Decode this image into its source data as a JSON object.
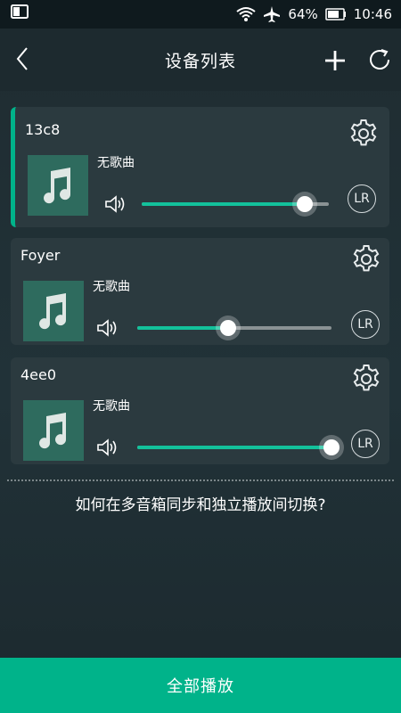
{
  "status_bar": {
    "battery": "64%",
    "time": "10:46"
  },
  "header": {
    "title": "设备列表"
  },
  "devices": [
    {
      "name": "13c8",
      "song": "无歌曲",
      "volume": 0.87,
      "channel": "LR",
      "active": true
    },
    {
      "name": "Foyer",
      "song": "无歌曲",
      "volume": 0.47,
      "channel": "LR",
      "active": false
    },
    {
      "name": "4ee0",
      "song": "无歌曲",
      "volume": 1.0,
      "channel": "LR",
      "active": false
    }
  ],
  "help_text": "如何在多音箱同步和独立播放间切换?",
  "bottom_button": "全部播放",
  "colors": {
    "accent": "#00b38a",
    "card": "#2b3a3f",
    "art": "#2e6b5e"
  }
}
